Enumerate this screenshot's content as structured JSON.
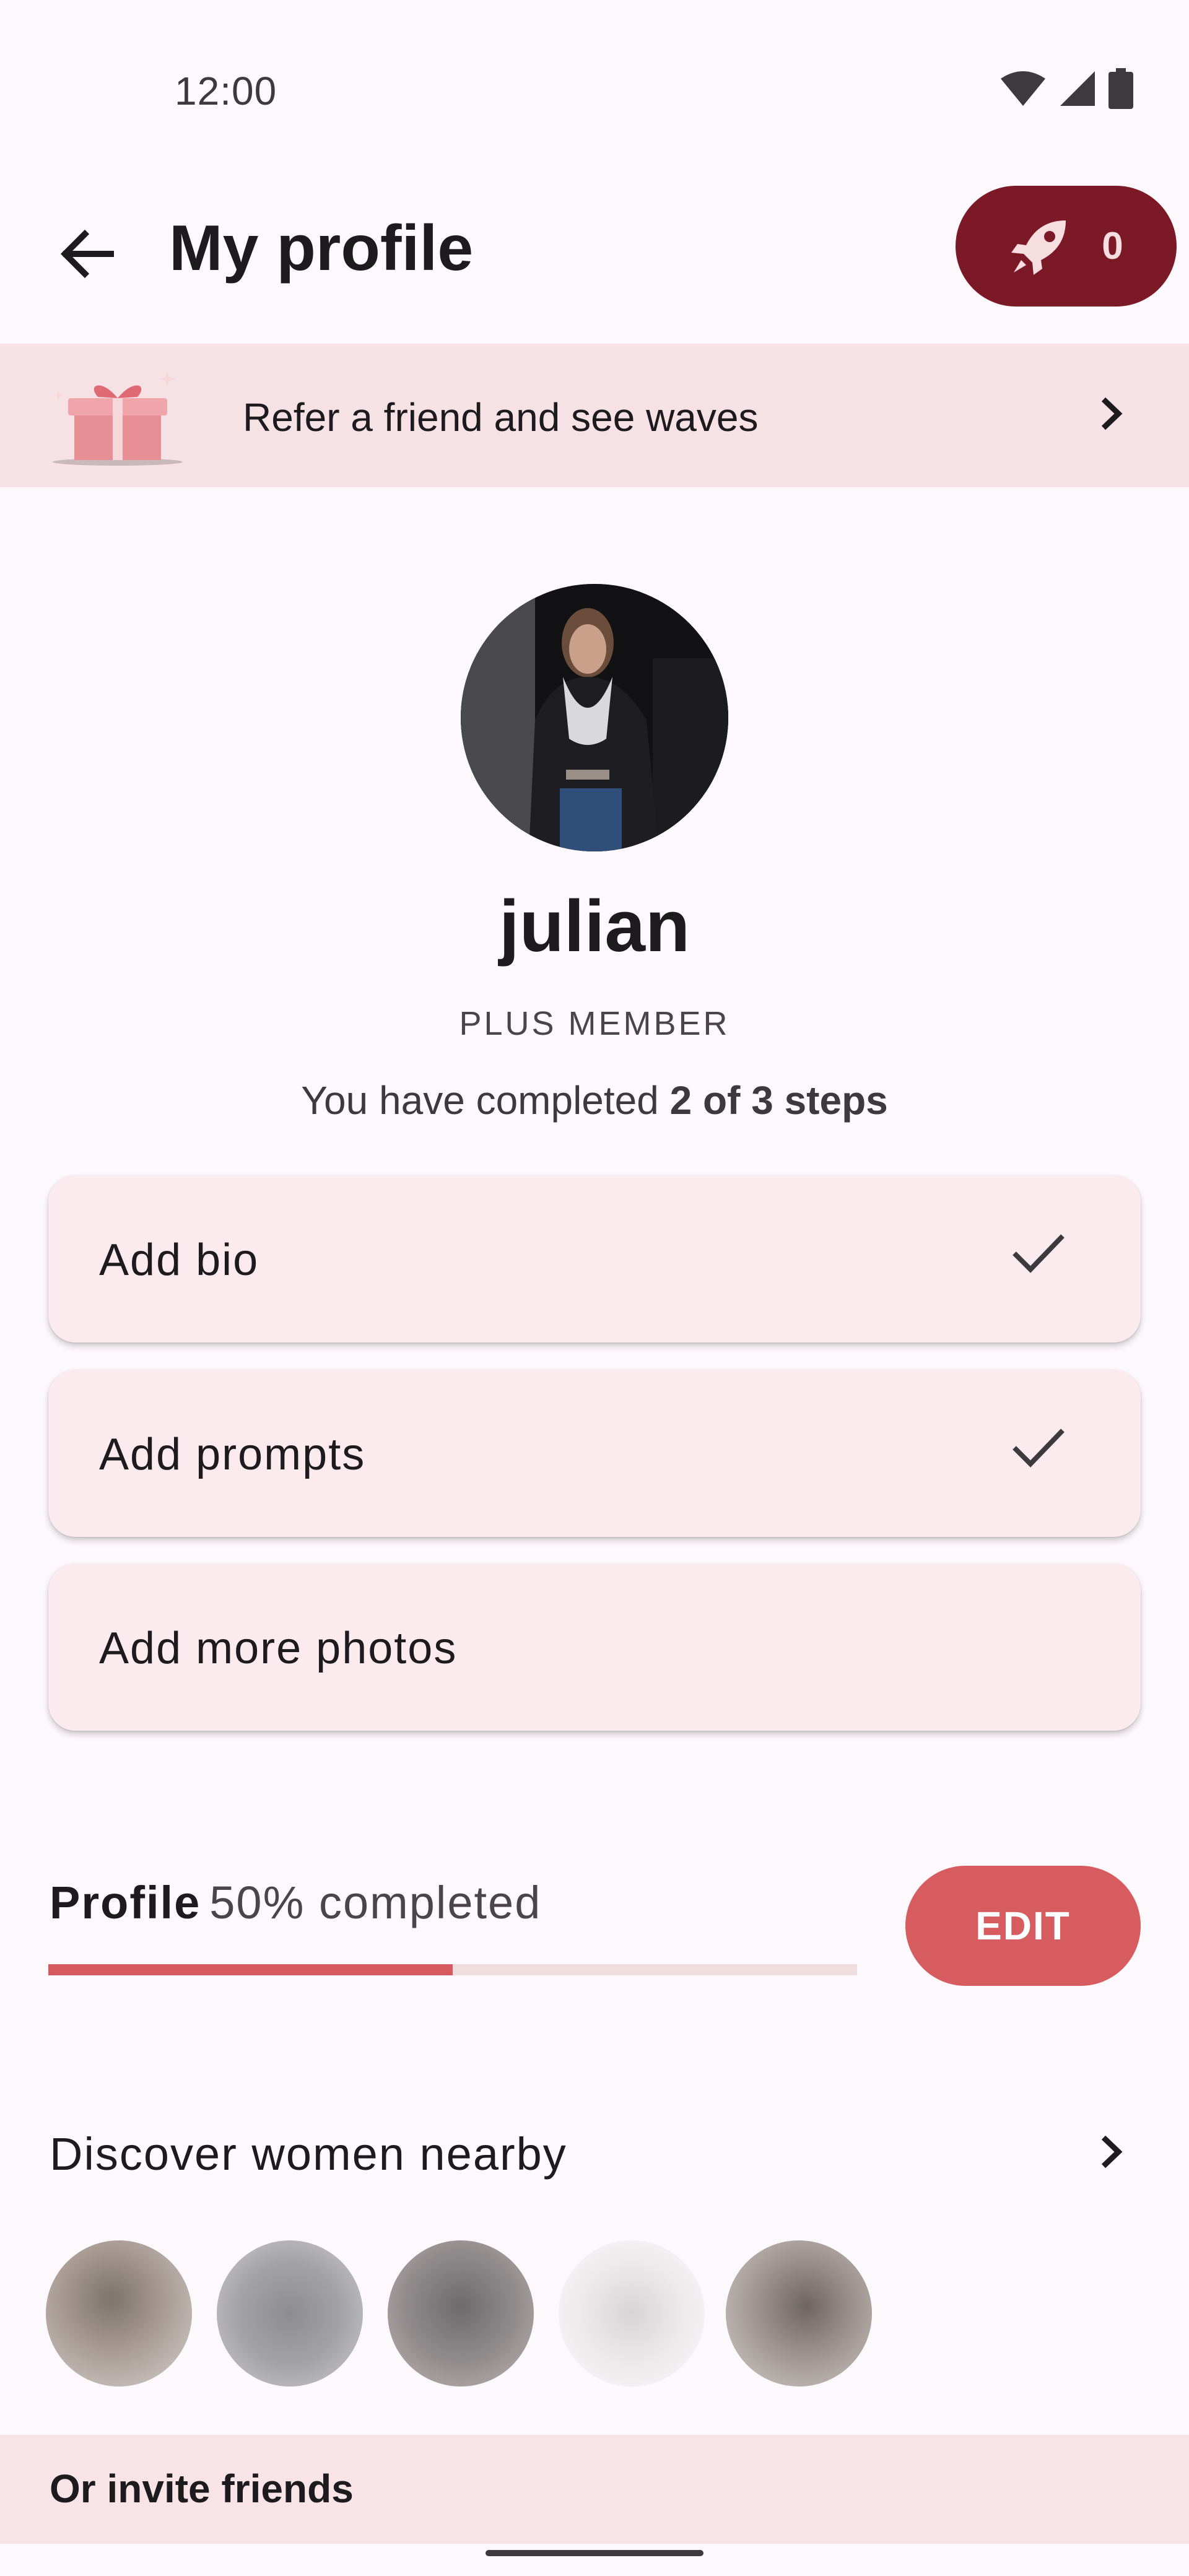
{
  "status_bar": {
    "time": "12:00",
    "icons": [
      "wifi-icon",
      "signal-icon",
      "battery-icon"
    ]
  },
  "app_bar": {
    "title": "My profile",
    "back_icon": "arrow-left-icon",
    "boost_icon": "rocket-icon",
    "boost_count": "0"
  },
  "refer_banner": {
    "icon": "gift-icon",
    "text": "Refer a friend and see waves",
    "chevron": "chevron-right-icon"
  },
  "profile": {
    "avatar": "profile-photo",
    "name": "julian",
    "membership": "PLUS MEMBER",
    "steps_prefix": "You have completed ",
    "steps_bold": "2 of 3 steps"
  },
  "steps": [
    {
      "label": "Add bio",
      "done": true
    },
    {
      "label": "Add prompts",
      "done": true
    },
    {
      "label": "Add more photos",
      "done": false
    }
  ],
  "progress": {
    "label": "Profile",
    "percent_text": "50% completed",
    "fraction": 0.5,
    "edit_label": "EDIT"
  },
  "discover": {
    "title": "Discover women nearby",
    "chevron": "chevron-right-icon",
    "avatar_count": 5
  },
  "invite": {
    "title": "Or invite friends"
  },
  "colors": {
    "accent": "#d75c60",
    "boost_bg": "#7b1a26",
    "banner_bg": "#f6e1e4",
    "card_bg": "#fbeaee"
  }
}
